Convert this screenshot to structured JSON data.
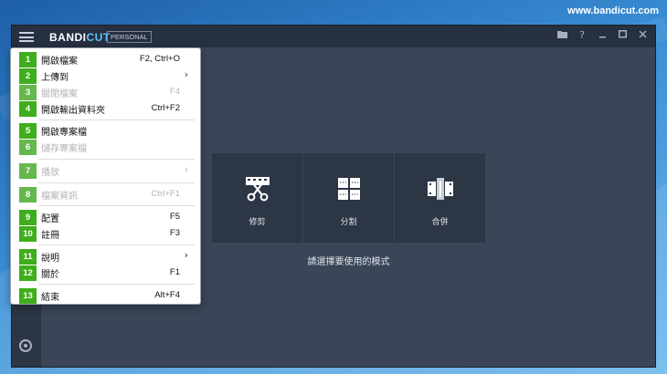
{
  "watermark": "www.bandicut.com",
  "app": {
    "logo_main": "BANDI",
    "logo_accent": "CUT",
    "plan": "PERSONAL",
    "titlebar_icons": [
      "folder-icon",
      "help-icon",
      "minimize-icon",
      "maximize-icon",
      "close-icon"
    ]
  },
  "menu": {
    "items": [
      {
        "num": "1",
        "label": "開啟檔案",
        "shortcut": "F2, Ctrl+O",
        "enabled": true,
        "submenu": false
      },
      {
        "num": "2",
        "label": "上傳到",
        "shortcut": "",
        "enabled": true,
        "submenu": true
      },
      {
        "num": "3",
        "label": "關閉檔案",
        "shortcut": "F4",
        "enabled": false,
        "submenu": false
      },
      {
        "num": "4",
        "label": "開啟輸出資料夾",
        "shortcut": "Ctrl+F2",
        "enabled": true,
        "submenu": false
      },
      {
        "num": "5",
        "label": "開啟專案檔",
        "shortcut": "",
        "enabled": true,
        "submenu": false
      },
      {
        "num": "6",
        "label": "儲存專案檔",
        "shortcut": "",
        "enabled": false,
        "submenu": false
      },
      {
        "num": "7",
        "label": "播放",
        "shortcut": "",
        "enabled": false,
        "submenu": true
      },
      {
        "num": "8",
        "label": "檔案資訊",
        "shortcut": "Ctrl+F1",
        "enabled": false,
        "submenu": false
      },
      {
        "num": "9",
        "label": "配置",
        "shortcut": "F5",
        "enabled": true,
        "submenu": false
      },
      {
        "num": "10",
        "label": "註冊",
        "shortcut": "F3",
        "enabled": true,
        "submenu": false
      },
      {
        "num": "11",
        "label": "說明",
        "shortcut": "",
        "enabled": true,
        "submenu": true
      },
      {
        "num": "12",
        "label": "關於",
        "shortcut": "F1",
        "enabled": true,
        "submenu": false
      },
      {
        "num": "13",
        "label": "結束",
        "shortcut": "Alt+F4",
        "enabled": true,
        "submenu": false
      }
    ]
  },
  "modes": [
    {
      "label": "修剪",
      "icon": "scissors-film-icon"
    },
    {
      "label": "分割",
      "icon": "split-grid-icon"
    },
    {
      "label": "合併",
      "icon": "merge-film-icon"
    }
  ],
  "hint": "請選擇要使用的模式",
  "colors": {
    "menu_number_bg": "#3fae1c",
    "app_bg": "#3a4657",
    "titlebar_bg": "#263040",
    "mode_tile_bg": "#2c3645",
    "logo_accent": "#5ec3ff"
  }
}
